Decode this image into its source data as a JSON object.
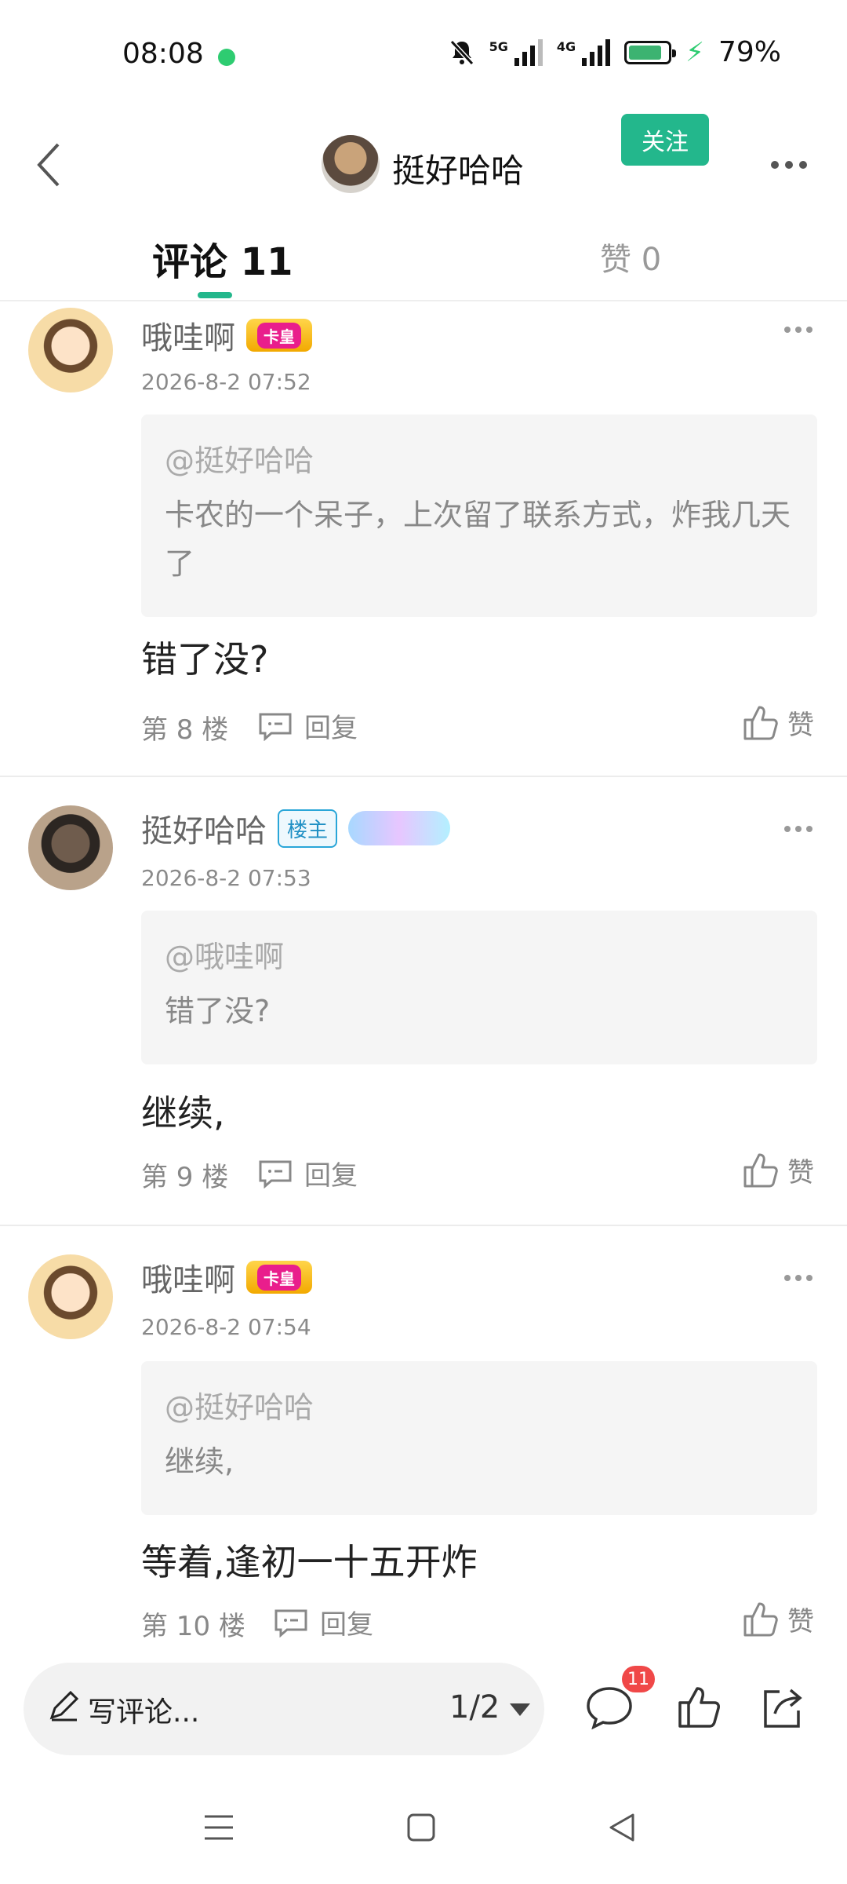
{
  "status_bar": {
    "time": "08:08",
    "network_5g": "5G",
    "network_4g": "4G",
    "battery": "79%",
    "battery_level": 0.79
  },
  "header": {
    "title": "挺好哈哈",
    "follow_label": "关注"
  },
  "tabs": {
    "comments": "评论 11",
    "likes": "赞 0"
  },
  "comments": [
    {
      "username": "哦哇啊",
      "badge": "卡皇",
      "time": "2026-8-2 07:52",
      "quote_at": "@挺好哈哈",
      "quote_text": "卡农的一个呆子，上次留了联系方式，炸我几天了",
      "content": "错了没?",
      "floor": "第 8 楼",
      "reply": "回复",
      "like": "赞"
    },
    {
      "username": "挺好哈哈",
      "badge": "楼主",
      "time": "2026-8-2 07:53",
      "quote_at": "@哦哇啊",
      "quote_text": "错了没?",
      "content": "继续,",
      "floor": "第 9 楼",
      "reply": "回复",
      "like": "赞"
    },
    {
      "username": "哦哇啊",
      "badge": "卡皇",
      "time": "2026-8-2 07:54",
      "quote_at": "@挺好哈哈",
      "quote_text": "继续,",
      "content": "等着,逢初一十五开炸",
      "floor": "第 10 楼",
      "reply": "回复",
      "like": "赞"
    }
  ],
  "bottom_bar": {
    "write_placeholder": "写评论...",
    "page": "1/2",
    "comment_count": "11"
  },
  "colors": {
    "accent": "#23b78c",
    "badge_red": "#f04848"
  }
}
